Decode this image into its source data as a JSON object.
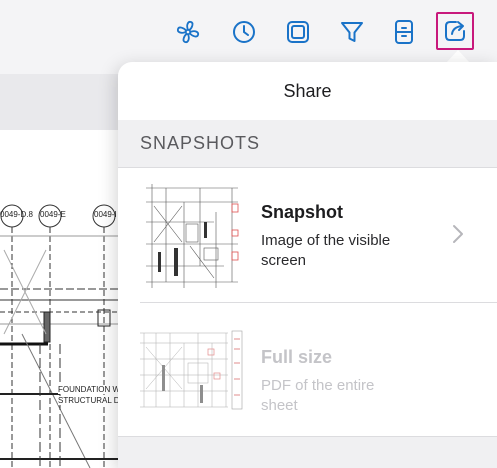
{
  "toolbar": {
    "buttons": [
      {
        "icon": "fan-icon"
      },
      {
        "icon": "clock-icon"
      },
      {
        "icon": "layers-icon"
      },
      {
        "icon": "filter-icon"
      },
      {
        "icon": "bookmark-sheet-icon"
      },
      {
        "icon": "share-icon",
        "active": true
      }
    ],
    "accent_color": "#1a73c8",
    "active_outline_color": "#c8197c"
  },
  "drawing": {
    "grid_labels": [
      "0049-D.8",
      "0049-E",
      "0049-I"
    ],
    "note_line1": "FOUNDATION WA",
    "note_line2": "STRUCTURAL DR"
  },
  "share_popover": {
    "title": "Share",
    "section_header": "SNAPSHOTS",
    "items": [
      {
        "title": "Snapshot",
        "subtitle": "Image of the visible screen",
        "enabled": true,
        "thumbnail_icon": "snapshot-thumbnail"
      },
      {
        "title": "Full size",
        "subtitle": "PDF of the entire sheet",
        "enabled": false,
        "thumbnail_icon": "full-sheet-thumbnail"
      }
    ]
  }
}
